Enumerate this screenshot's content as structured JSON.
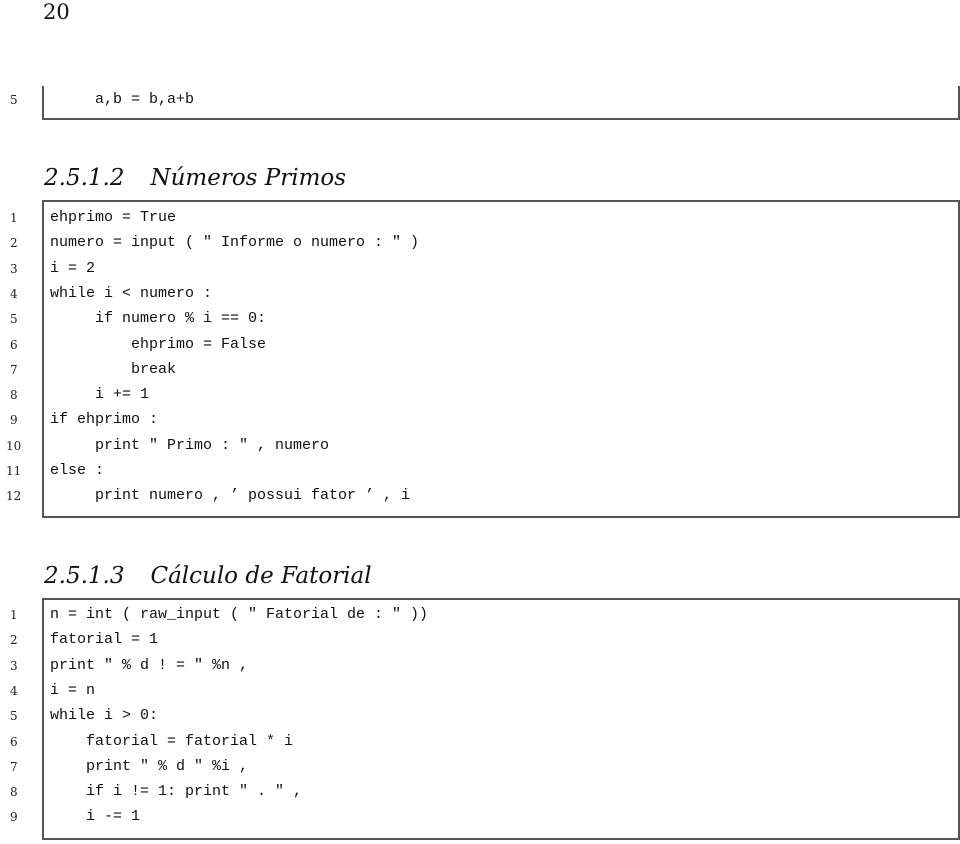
{
  "page_number": "20",
  "prev_listing": {
    "lines": [
      {
        "n": "5",
        "code": "     a,b = b,a+b"
      }
    ]
  },
  "sections": [
    {
      "number": "2.5.1.2",
      "title": "Números Primos",
      "lines": [
        {
          "n": "1",
          "code": "ehprimo = True"
        },
        {
          "n": "2",
          "code": "numero = input ( \" Informe o numero : \" )"
        },
        {
          "n": "3",
          "code": "i = 2"
        },
        {
          "n": "4",
          "code": "while i < numero :"
        },
        {
          "n": "5",
          "code": "     if numero % i == 0:"
        },
        {
          "n": "6",
          "code": "         ehprimo = False"
        },
        {
          "n": "7",
          "code": "         break"
        },
        {
          "n": "8",
          "code": "     i += 1"
        },
        {
          "n": "9",
          "code": "if ehprimo :"
        },
        {
          "n": "10",
          "code": "     print \" Primo : \" , numero"
        },
        {
          "n": "11",
          "code": "else :"
        },
        {
          "n": "12",
          "code": "     print numero , ’ possui fator ’ , i"
        }
      ]
    },
    {
      "number": "2.5.1.3",
      "title": "Cálculo de Fatorial",
      "lines": [
        {
          "n": "1",
          "code": "n = int ( raw_input ( \" Fatorial de : \" ))"
        },
        {
          "n": "2",
          "code": "fatorial = 1"
        },
        {
          "n": "3",
          "code": "print \" % d ! = \" %n ,"
        },
        {
          "n": "4",
          "code": "i = n"
        },
        {
          "n": "5",
          "code": "while i > 0:"
        },
        {
          "n": "6",
          "code": "    fatorial = fatorial * i"
        },
        {
          "n": "7",
          "code": "    print \" % d \" %i ,"
        },
        {
          "n": "8",
          "code": "    if i != 1: print \" . \" ,"
        },
        {
          "n": "9",
          "code": "    i -= 1"
        }
      ]
    }
  ]
}
